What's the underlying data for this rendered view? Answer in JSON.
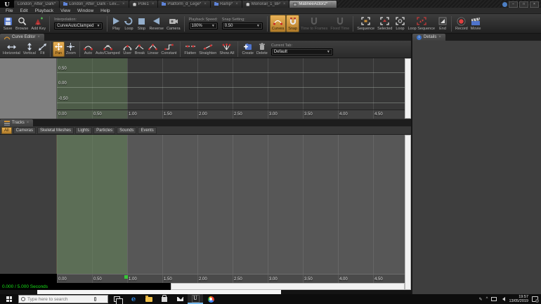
{
  "titlebar": {
    "tabs": [
      {
        "label": "London_After_Dark*"
      },
      {
        "label": "London_After_Dark - Lev..."
      },
      {
        "label": "Pole1"
      },
      {
        "label": "Platform_d_Lege*"
      },
      {
        "label": "Ramp*"
      },
      {
        "label": "Monorail_1_BP"
      },
      {
        "label": "MatineeActor2*"
      }
    ],
    "window_controls": {
      "minimize": "–",
      "maximize": "□",
      "close": "×"
    }
  },
  "menubar": {
    "items": [
      "File",
      "Edit",
      "Playback",
      "View",
      "Window",
      "Help"
    ]
  },
  "toolbar": {
    "save": "Save",
    "browse": "Browse",
    "add_key": "Add Key",
    "interpolation_label": "Interpolation:",
    "interpolation_value": "CurveAutoClamped",
    "play": "Play",
    "loop": "Loop",
    "stop": "Stop",
    "reverse": "Reverse",
    "camera": "Camera",
    "playback_speed_label": "Playback Speed:",
    "playback_speed_value": "100%",
    "snap_setting_label": "Snap Setting:",
    "snap_setting_value": "0.50",
    "curves": "Curves",
    "snap": "Snap",
    "time_to_frames": "Time to Frames",
    "fixed_time": "Fixed Time",
    "sequence": "Sequence",
    "selected": "Selected",
    "loop_small": "Loop",
    "loop_sequence": "Loop Sequence",
    "end": "End",
    "record": "Record",
    "movie": "Movie"
  },
  "curve_editor": {
    "title": "Curve Editor",
    "buttons": [
      "Horizontal",
      "Vertical",
      "Fit",
      "Pan",
      "Zoom",
      "Auto",
      "Auto/Clamped",
      "User",
      "Break",
      "Linear",
      "Constant",
      "Flatten",
      "Straighten",
      "Show All",
      "Create",
      "Delete"
    ],
    "active_button": "Pan",
    "current_tab_label": "Current Tab:",
    "current_tab_value": "Default",
    "y_axis": [
      "0.50",
      "0.00",
      "-0.50"
    ],
    "x_axis": [
      "0.00",
      "0.50",
      "1.00",
      "1.50",
      "2.00",
      "2.50",
      "3.00",
      "3.50",
      "4.00",
      "4.50"
    ]
  },
  "tracks": {
    "title": "Tracks",
    "filters": [
      "All",
      "Cameras",
      "Skeletal Meshes",
      "Lights",
      "Particles",
      "Sounds",
      "Events"
    ],
    "active_filter": "All",
    "x_axis": [
      "0.00",
      "0.50",
      "1.00",
      "1.50",
      "2.00",
      "2.50",
      "3.00",
      "3.50",
      "4.00",
      "4.50"
    ],
    "time_status": "0.000 / 5.000 Seconds"
  },
  "details": {
    "title": "Details"
  },
  "taskbar": {
    "search_placeholder": "Type here to search",
    "time": "19:57",
    "date": "13/05/2019"
  },
  "colors": {
    "accent_orange": "#cf9136",
    "loop_section_green": "#5d7354",
    "status_green": "#17e017",
    "taskbar_active_underline": "#76b9ed"
  }
}
